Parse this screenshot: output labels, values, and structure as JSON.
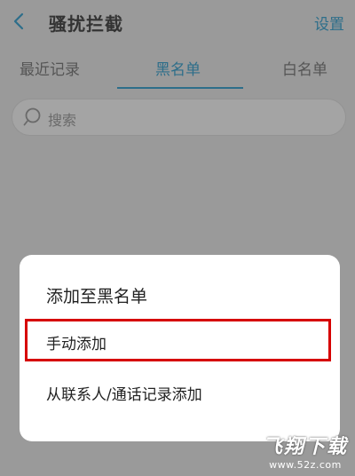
{
  "header": {
    "title": "骚扰拦截",
    "settings_label": "设置",
    "back_icon": "chevron-left-icon"
  },
  "tabs": [
    {
      "label": "最近记录",
      "active": false
    },
    {
      "label": "黑名单",
      "active": true
    },
    {
      "label": "白名单",
      "active": false
    }
  ],
  "search": {
    "placeholder": "搜索",
    "icon": "search-icon"
  },
  "dialog": {
    "title": "添加至黑名单",
    "options": [
      {
        "label": "手动添加",
        "highlighted": true
      },
      {
        "label": "从联系人/通话记录添加",
        "highlighted": false
      }
    ],
    "highlight_color": "#d60000"
  },
  "colors": {
    "accent": "#2d6e8a",
    "overlay_background": "#9a9a9a"
  },
  "watermark": {
    "main": "飞翔下载",
    "url": "www.52z.com"
  }
}
